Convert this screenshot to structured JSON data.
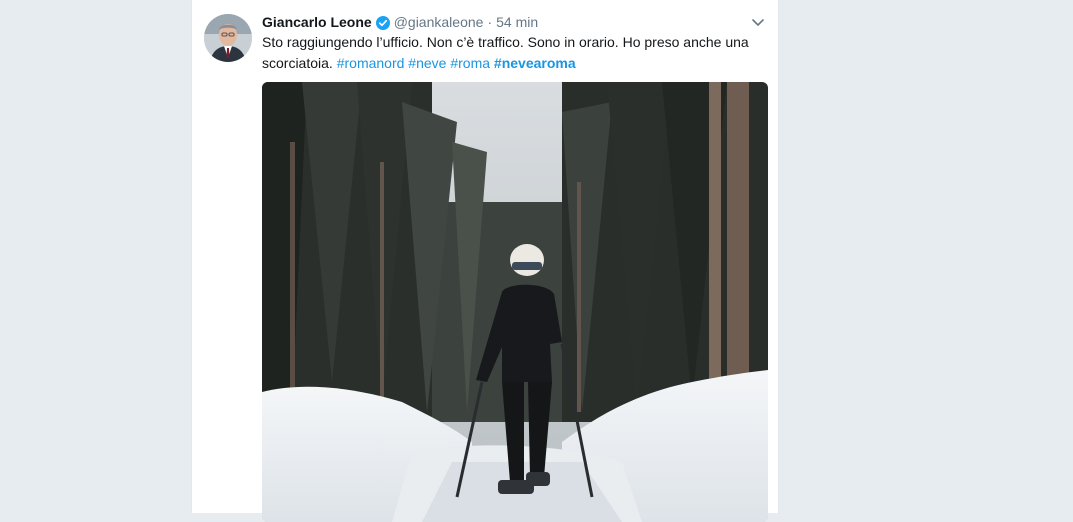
{
  "tweet": {
    "author_name": "Giancarlo Leone",
    "handle": "@giankaleone",
    "separator": "·",
    "time": "54 min",
    "text_line1": "Sto raggiungendo l’ufficio. Non c’è traffico. Sono in orario. Ho preso anche una",
    "text_line2_start": "scorciatoia.",
    "hashtags": [
      "#romanord",
      "#neve",
      "#roma",
      "#nevearoma"
    ],
    "media": {
      "description_icon": "video-thumbnail"
    }
  },
  "icons": {
    "verified": "verified-badge-icon",
    "caret": "chevron-down-icon"
  },
  "colors": {
    "background": "#e6ecf0",
    "card": "#ffffff",
    "link": "#1b95e0",
    "muted": "#657786",
    "text": "#14171a",
    "verified": "#1da1f2"
  }
}
